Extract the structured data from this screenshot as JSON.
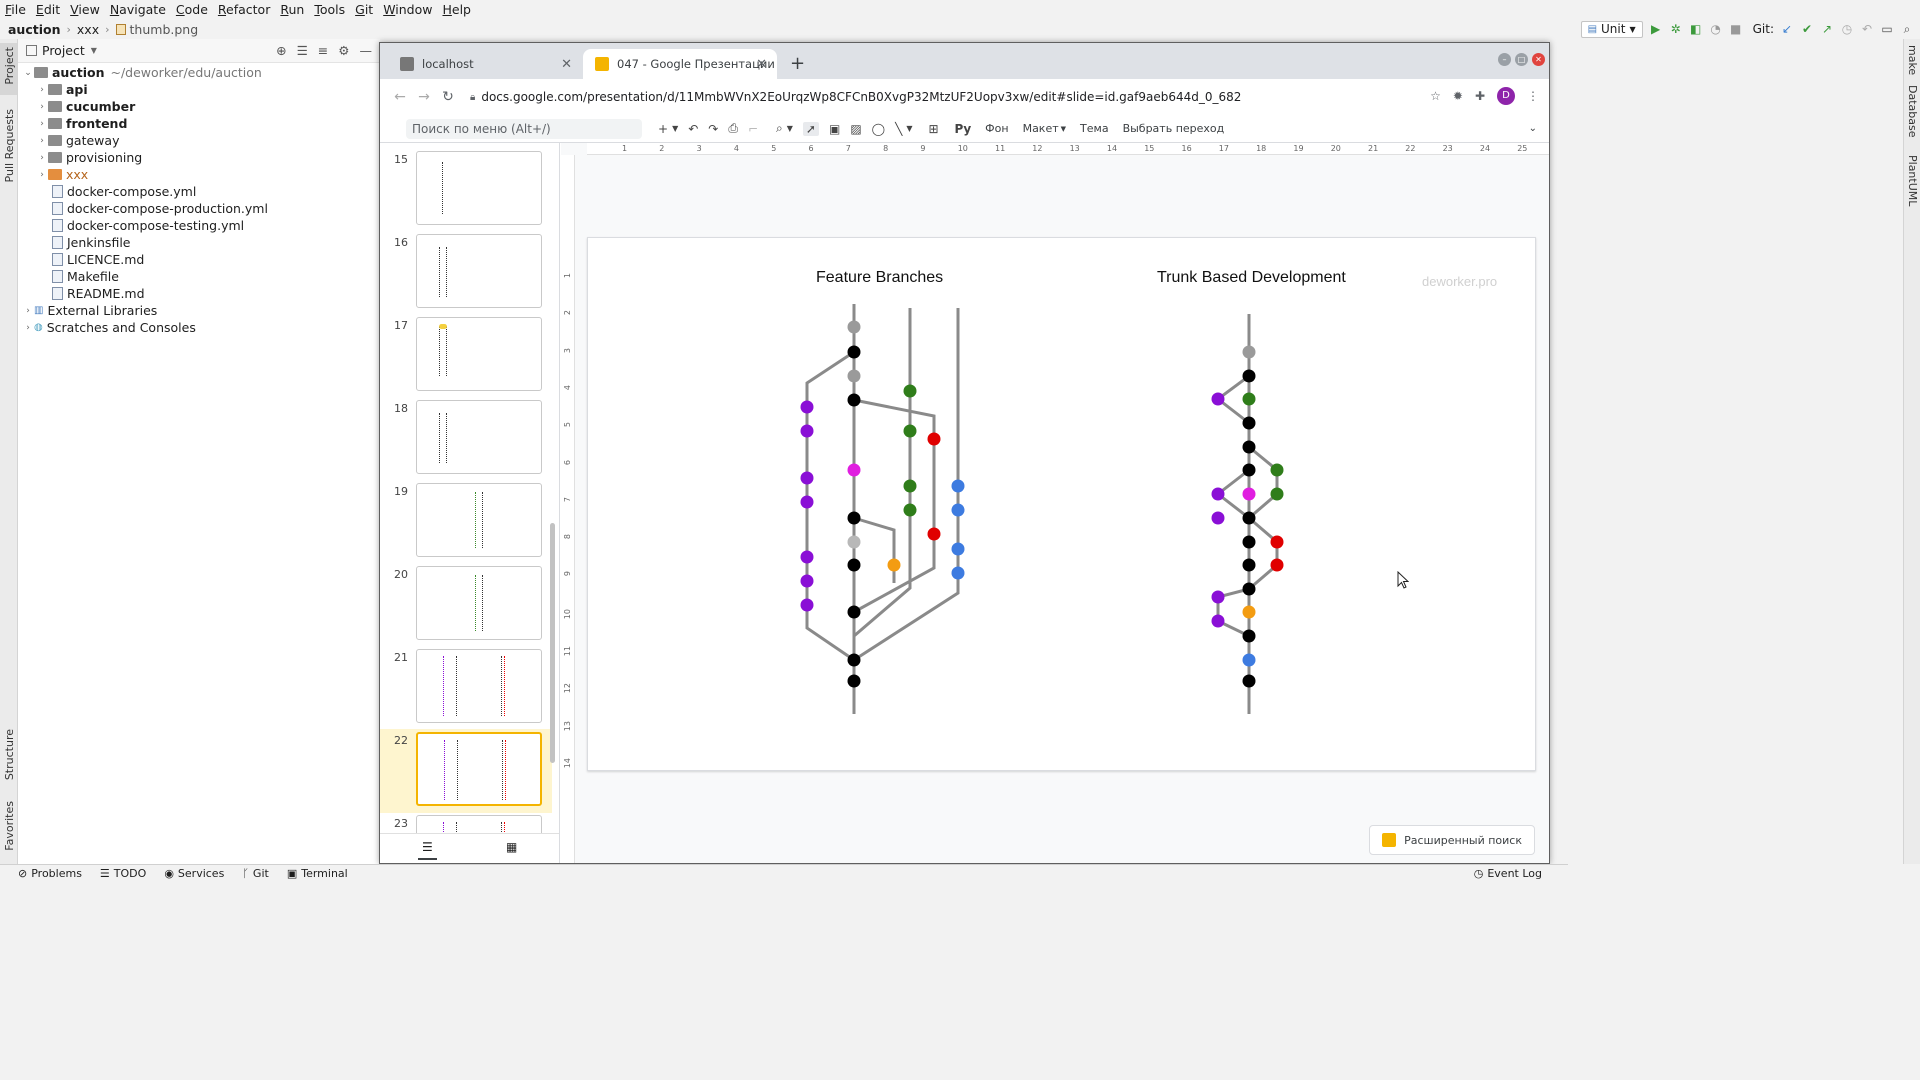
{
  "ide": {
    "menu": [
      "File",
      "Edit",
      "View",
      "Navigate",
      "Code",
      "Refactor",
      "Run",
      "Tools",
      "Git",
      "Window",
      "Help"
    ],
    "breadcrumb": [
      "auction",
      "xxx",
      "thumb.png"
    ],
    "run_config": "Unit",
    "git_label": "Git:",
    "left_tabs": [
      "Project",
      "Pull Requests",
      "Structure",
      "Favorites"
    ],
    "right_tabs": [
      "make",
      "Database",
      "PlantUML"
    ],
    "project_panel": {
      "title": "Project",
      "root": "auction",
      "root_path": "~/deworker/edu/auction",
      "items": [
        {
          "label": "api",
          "type": "folder",
          "bold": true
        },
        {
          "label": "cucumber",
          "type": "folder",
          "bold": true
        },
        {
          "label": "frontend",
          "type": "folder",
          "bold": true
        },
        {
          "label": "gateway",
          "type": "folder",
          "bold": false
        },
        {
          "label": "provisioning",
          "type": "folder",
          "bold": false
        },
        {
          "label": "xxx",
          "type": "folder-orange",
          "bold": false
        },
        {
          "label": "docker-compose.yml",
          "type": "file"
        },
        {
          "label": "docker-compose-production.yml",
          "type": "file"
        },
        {
          "label": "docker-compose-testing.yml",
          "type": "file"
        },
        {
          "label": "Jenkinsfile",
          "type": "file"
        },
        {
          "label": "LICENCE.md",
          "type": "file"
        },
        {
          "label": "Makefile",
          "type": "file"
        },
        {
          "label": "README.md",
          "type": "file"
        }
      ],
      "external": "External Libraries",
      "scratches": "Scratches and Consoles"
    },
    "status": [
      "Problems",
      "TODO",
      "Services",
      "Git",
      "Terminal"
    ],
    "event_log": "Event Log"
  },
  "browser": {
    "tabs": [
      {
        "title": "localhost",
        "active": false
      },
      {
        "title": "047 - Google Презентации",
        "active": true
      }
    ],
    "url": "docs.google.com/presentation/d/11MmbWVnX2EoUrqzWp8CFCnB0XvgP32MtzUF2Uopv3xw/edit#slide=id.gaf9aeb644d_0_682",
    "avatar_letter": "D"
  },
  "slides_ui": {
    "menu_search_placeholder": "Поиск по меню (Alt+/)",
    "toolbar_text": [
      "Фон",
      "Макет",
      "Тема",
      "Выбрать переход"
    ],
    "thumb_numbers": [
      "15",
      "16",
      "17",
      "18",
      "19",
      "20",
      "21",
      "22",
      "23"
    ],
    "selected_slide": "22",
    "explore_label": "Расширенный поиск",
    "ruler_h": [
      "1",
      "2",
      "3",
      "4",
      "5",
      "6",
      "7",
      "8",
      "9",
      "10",
      "11",
      "12",
      "13",
      "14",
      "15",
      "16",
      "17",
      "18",
      "19",
      "20",
      "21",
      "22",
      "23",
      "24",
      "25"
    ],
    "ruler_v": [
      "1",
      "2",
      "3",
      "4",
      "5",
      "6",
      "7",
      "8",
      "9",
      "10",
      "11",
      "12",
      "13",
      "14"
    ]
  },
  "slide": {
    "title_left": "Feature Branches",
    "title_right": "Trunk Based Development",
    "watermark": "deworker.pro",
    "colors": {
      "line": "#8a8a8a",
      "black": "#000000",
      "grey": "#9a9a9a",
      "purple": "#8a0fd6",
      "green": "#2f7d1a",
      "red": "#e00000",
      "magenta": "#e01ee0",
      "orange": "#f39c12",
      "blue": "#3d7be0",
      "lightgrey": "#b8b8b8"
    }
  }
}
